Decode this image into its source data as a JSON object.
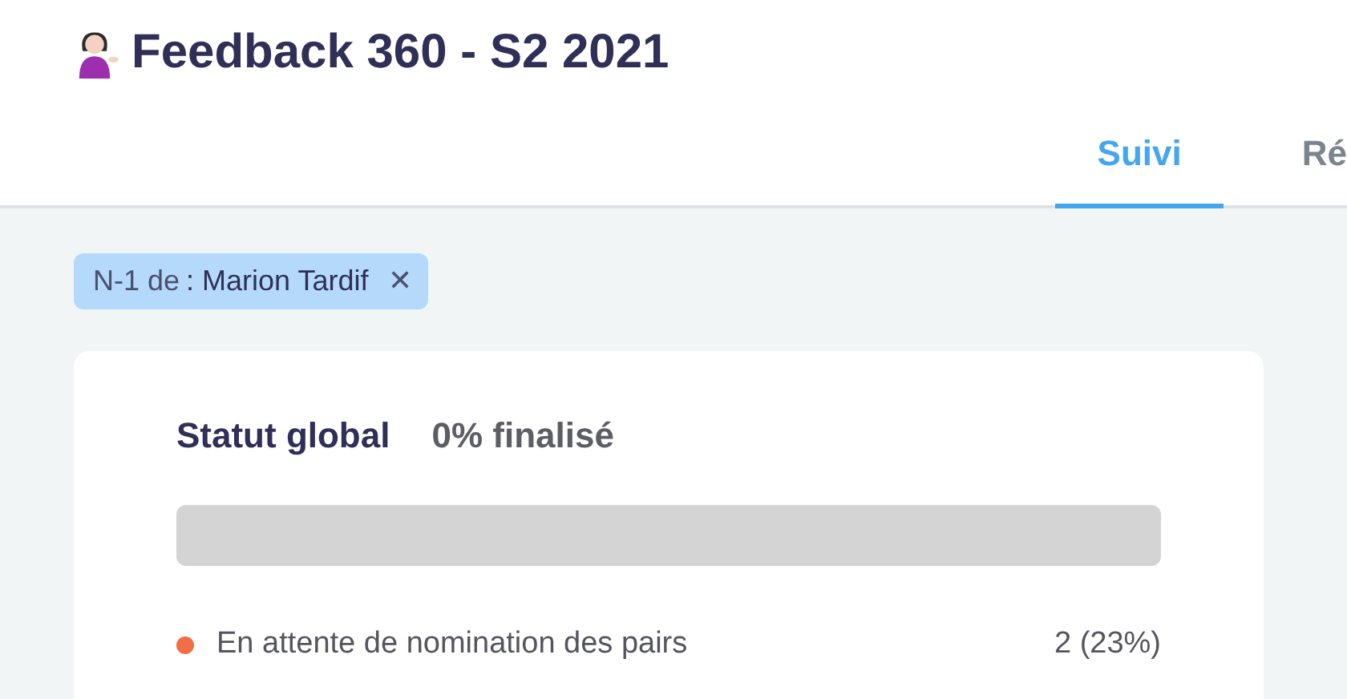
{
  "header": {
    "title": "Feedback 360 - S2 2021"
  },
  "tabs": [
    {
      "label": "Suivi",
      "selected": true
    },
    {
      "label": "Ré",
      "selected": false
    }
  ],
  "filter_chip": {
    "label": "N-1 de",
    "value": ": Marion Tardif",
    "remove": "✕"
  },
  "status_card": {
    "title": "Statut global",
    "summary": "0% finalisé",
    "level": 0,
    "rows": [
      {
        "label": "En attente de nomination des pairs",
        "count": "2 (23%)",
        "color": "#f26e46"
      }
    ]
  }
}
